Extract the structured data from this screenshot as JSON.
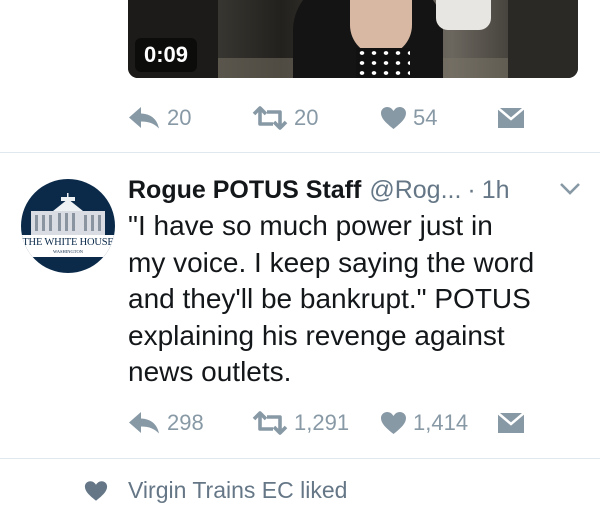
{
  "top_tweet": {
    "video": {
      "duration": "0:09"
    },
    "actions": {
      "replies": "20",
      "retweets": "20",
      "likes": "54"
    }
  },
  "tweet": {
    "author_name": "Rogue POTUS Staff",
    "author_handle": "@Rog...",
    "separator": "·",
    "time": "1h",
    "text": "\"I have so much power just in\nmy voice. I keep saying the word\nand they'll be bankrupt.\" POTUS\nexplaining his revenge against\nnews outlets.",
    "avatar": {
      "label": "THE WHITE HOUSE",
      "sublabel": "WASHINGTON"
    },
    "actions": {
      "replies": "298",
      "retweets": "1,291",
      "likes": "1,414"
    }
  },
  "liked_notice": {
    "text": "Virgin Trains EC liked"
  },
  "colors": {
    "icon_gray": "#8899a6",
    "text_dark": "#14171a",
    "text_muted": "#657786",
    "divider": "#e1e8ed"
  }
}
